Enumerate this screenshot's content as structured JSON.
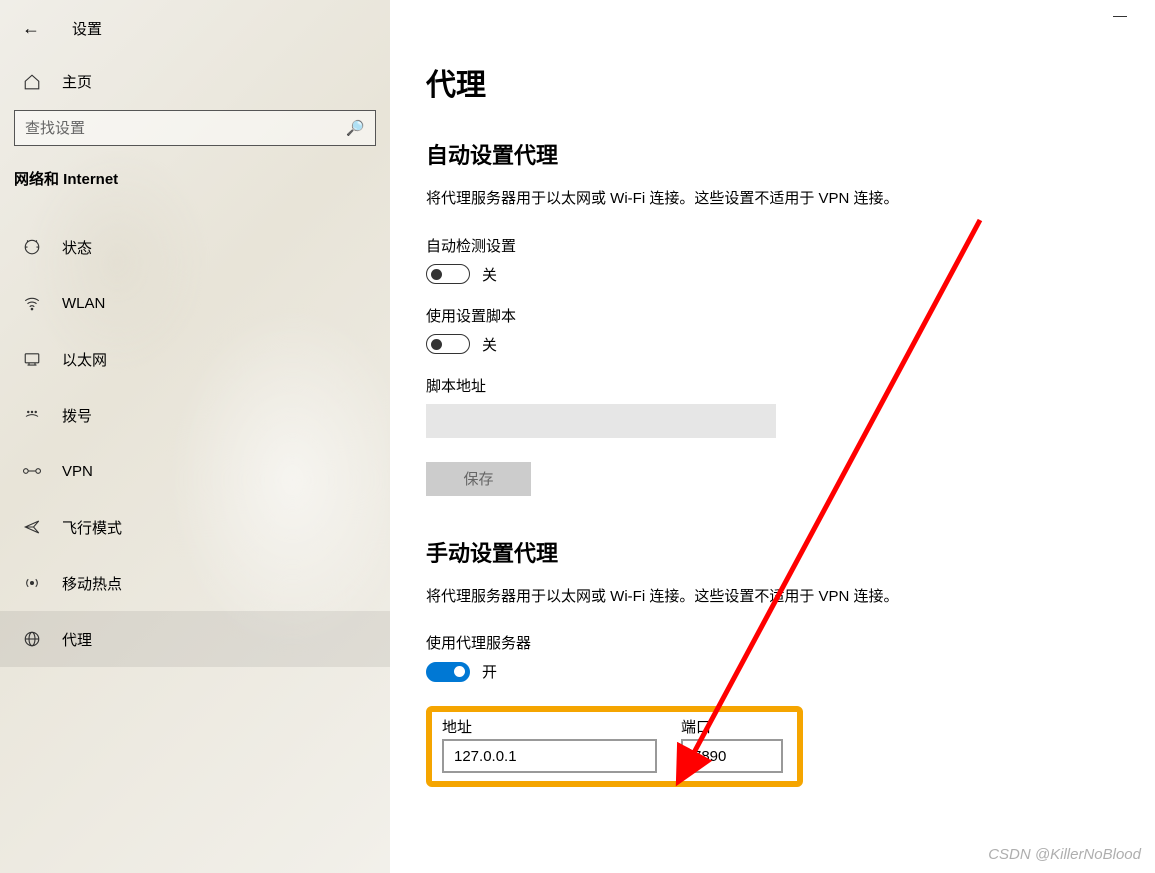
{
  "window": {
    "title": "设置",
    "minimize": "—"
  },
  "sidebar": {
    "home_label": "主页",
    "search_placeholder": "查找设置",
    "category": "网络和 Internet",
    "items": [
      {
        "icon": "status",
        "label": "状态"
      },
      {
        "icon": "wifi",
        "label": "WLAN"
      },
      {
        "icon": "ethernet",
        "label": "以太网"
      },
      {
        "icon": "dialup",
        "label": "拨号"
      },
      {
        "icon": "vpn",
        "label": "VPN"
      },
      {
        "icon": "airplane",
        "label": "飞行模式"
      },
      {
        "icon": "hotspot",
        "label": "移动热点"
      },
      {
        "icon": "proxy",
        "label": "代理"
      }
    ]
  },
  "main": {
    "title": "代理",
    "auto_section": {
      "title": "自动设置代理",
      "desc": "将代理服务器用于以太网或 Wi-Fi 连接。这些设置不适用于 VPN 连接。",
      "auto_detect_label": "自动检测设置",
      "auto_detect_state": "关",
      "use_script_label": "使用设置脚本",
      "use_script_state": "关",
      "script_addr_label": "脚本地址",
      "save_label": "保存"
    },
    "manual_section": {
      "title": "手动设置代理",
      "desc": "将代理服务器用于以太网或 Wi-Fi 连接。这些设置不适用于 VPN 连接。",
      "use_proxy_label": "使用代理服务器",
      "use_proxy_state": "开",
      "address_label": "地址",
      "address_value": "127.0.0.1",
      "port_label": "端口",
      "port_value": "7890"
    }
  },
  "annotation": {
    "highlight_color": "#f5a500",
    "arrow_color": "#ff0000"
  },
  "watermark": "CSDN @KillerNoBlood"
}
